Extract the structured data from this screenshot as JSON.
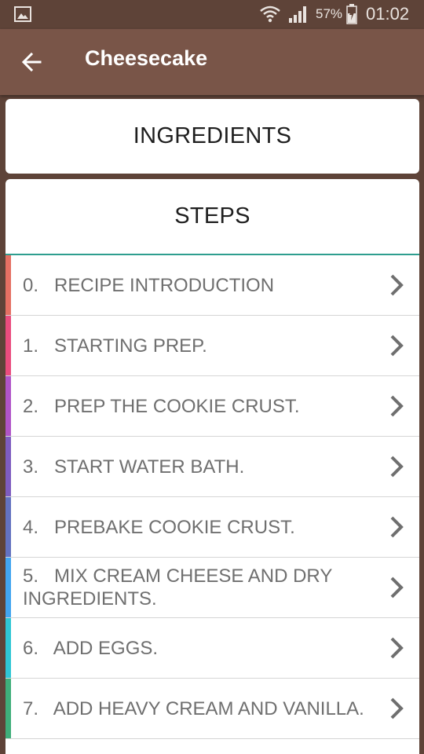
{
  "status_bar": {
    "battery_percent": "57%",
    "time": "01:02",
    "icons": [
      "image-notification-icon",
      "wifi-icon",
      "signal-icon",
      "battery-charging-icon"
    ]
  },
  "app_bar": {
    "title": "Cheesecake",
    "back_icon": "arrow-back-icon",
    "background": "#795548"
  },
  "ingredients": {
    "label": "INGREDIENTS"
  },
  "steps": {
    "label": "STEPS",
    "accent": "#2e9e8f",
    "items": [
      {
        "number": "0.",
        "title": "RECIPE INTRODUCTION",
        "color": "#e57063"
      },
      {
        "number": "1.",
        "title": "STARTING PREP.",
        "color": "#ea4c7e"
      },
      {
        "number": "2.",
        "title": "PREP THE COOKIE CRUST.",
        "color": "#b054c8"
      },
      {
        "number": "3.",
        "title": "START WATER BATH.",
        "color": "#7e5cc0"
      },
      {
        "number": "4.",
        "title": "PREBAKE COOKIE CRUST.",
        "color": "#6372c0"
      },
      {
        "number": "5.",
        "title": "MIX CREAM CHEESE AND DRY INGREDIENTS.",
        "color": "#42a5f0"
      },
      {
        "number": "6.",
        "title": "ADD EGGS.",
        "color": "#2fc6d4"
      },
      {
        "number": "7.",
        "title": "ADD HEAVY CREAM AND VANILLA.",
        "color": "#3fae7a"
      }
    ]
  }
}
